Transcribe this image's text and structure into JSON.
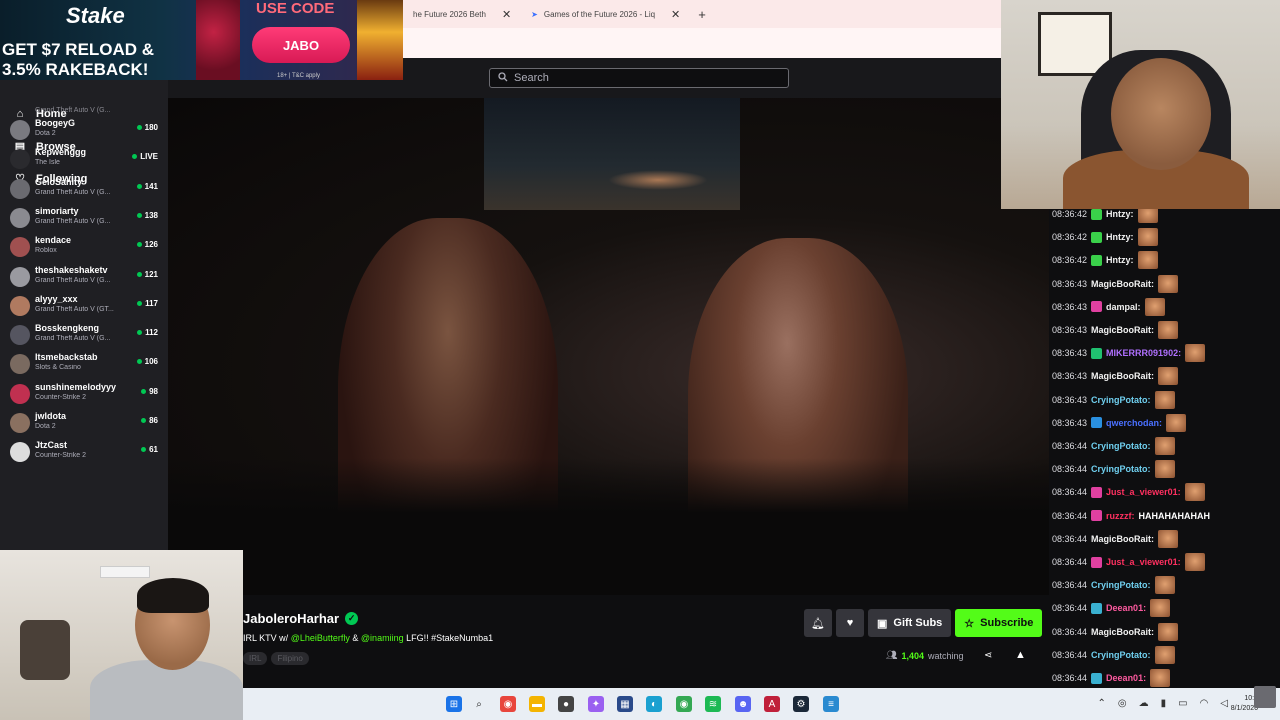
{
  "ad": {
    "brand": "Stake",
    "headline_line1": "GET $7 RELOAD &",
    "headline_line2": "3.5% RAKEBACK!",
    "use_code_label": "USE CODE",
    "code": "JABO",
    "fine_print": "18+ | T&C apply"
  },
  "browser": {
    "tabs": [
      {
        "label": "he Future 2026 Beth"
      },
      {
        "label": "Games of the Future 2026 - Liq"
      }
    ],
    "new_tab": "+"
  },
  "search": {
    "placeholder": "Search"
  },
  "sidebar": {
    "nav": [
      {
        "label": "Home",
        "icon": "home-icon"
      },
      {
        "label": "Browse",
        "icon": "browse-icon"
      },
      {
        "label": "Following",
        "icon": "heart-icon"
      }
    ],
    "partial_row": "Grand Theft Auto V (G...",
    "channels": [
      {
        "name": "BoogeyG",
        "game": "Dota 2",
        "viewers": "180",
        "color": "#7a7a80"
      },
      {
        "name": "Kepwenggg",
        "game": "The Isle",
        "viewers": "LIVE",
        "color": "#2a2a2e"
      },
      {
        "name": "GeloSanity",
        "game": "Grand Theft Auto V (G...",
        "viewers": "141",
        "color": "#6a6a70"
      },
      {
        "name": "simoriarty",
        "game": "Grand Theft Auto V (G...",
        "viewers": "138",
        "color": "#8a8a90"
      },
      {
        "name": "kendace",
        "game": "Roblox",
        "viewers": "126",
        "color": "#a05050"
      },
      {
        "name": "theshakeshaketv",
        "game": "Grand Theft Auto V (G...",
        "viewers": "121",
        "color": "#9a9aa0"
      },
      {
        "name": "alyyy_xxx",
        "game": "Grand Theft Auto V (GT...",
        "viewers": "117",
        "color": "#b07a60"
      },
      {
        "name": "Bosskengkeng",
        "game": "Grand Theft Auto V (G...",
        "viewers": "112",
        "color": "#555560"
      },
      {
        "name": "Itsmebackstab",
        "game": "Slots & Casino",
        "viewers": "106",
        "color": "#7a6a60"
      },
      {
        "name": "sunshinemelodyyy",
        "game": "Counter-Strike 2",
        "viewers": "98",
        "color": "#c03050"
      },
      {
        "name": "jwldota",
        "game": "Dota 2",
        "viewers": "86",
        "color": "#8a7060"
      },
      {
        "name": "JtzCast",
        "game": "Counter-Strike 2",
        "viewers": "61",
        "color": "#dddddd"
      }
    ]
  },
  "stream": {
    "streamer": "JaboleroHarhar",
    "title_prefix": "IRL KTV w/",
    "mention1": "@LheiButterfly",
    "amp": "&",
    "mention2": "@inamiing",
    "title_suffix": "LFG!! #StakeNumba1",
    "tags": [
      "IRL",
      "Filipino"
    ],
    "gift_label": "Gift Subs",
    "subscribe_label": "Subscribe",
    "viewer_count": "1,404",
    "viewer_suffix": "watching",
    "accent_color": "#53fc18"
  },
  "chat": {
    "messages": [
      {
        "time": "08:36:42",
        "user": "Hntzy:",
        "color": "#f2f2f2",
        "badge": "#3ad04a",
        "text": "",
        "emote": true
      },
      {
        "time": "08:36:42",
        "user": "Hntzy:",
        "color": "#f2f2f2",
        "badge": "#3ad04a",
        "text": "",
        "emote": true
      },
      {
        "time": "08:36:42",
        "user": "Hntzy:",
        "color": "#f2f2f2",
        "badge": "#3ad04a",
        "text": "",
        "emote": true
      },
      {
        "time": "08:36:43",
        "user": "MagicBooRait:",
        "color": "#f2f2f2",
        "badge": "",
        "text": "",
        "emote": true
      },
      {
        "time": "08:36:43",
        "user": "dampal:",
        "color": "#f2f2f2",
        "badge": "#e040a0",
        "text": "",
        "emote": true
      },
      {
        "time": "08:36:43",
        "user": "MagicBooRait:",
        "color": "#f2f2f2",
        "badge": "",
        "text": "",
        "emote": true
      },
      {
        "time": "08:36:43",
        "user": "MIKERRR091902:",
        "color": "#b070ff",
        "badge": "#20c070",
        "text": "",
        "emote": true
      },
      {
        "time": "08:36:43",
        "user": "MagicBooRait:",
        "color": "#f2f2f2",
        "badge": "",
        "text": "",
        "emote": true
      },
      {
        "time": "08:36:43",
        "user": "CryingPotato:",
        "color": "#70d0f0",
        "badge": "",
        "text": "",
        "emote": true
      },
      {
        "time": "08:36:43",
        "user": "qwerchodan:",
        "color": "#4a70ff",
        "badge": "#2a90e0",
        "text": "",
        "emote": true
      },
      {
        "time": "08:36:44",
        "user": "CryingPotato:",
        "color": "#70d0f0",
        "badge": "",
        "text": "",
        "emote": true
      },
      {
        "time": "08:36:44",
        "user": "CryingPotato:",
        "color": "#70d0f0",
        "badge": "",
        "text": "",
        "emote": true
      },
      {
        "time": "08:36:44",
        "user": "Just_a_viewer01:",
        "color": "#ff3060",
        "badge": "#e040a0",
        "text": "",
        "emote": true
      },
      {
        "time": "08:36:44",
        "user": "ruzzzf:",
        "color": "#ff3060",
        "badge": "#e040a0",
        "text": "HAHAHAHAHAH",
        "emote": false
      },
      {
        "time": "08:36:44",
        "user": "MagicBooRait:",
        "color": "#f2f2f2",
        "badge": "",
        "text": "",
        "emote": true
      },
      {
        "time": "08:36:44",
        "user": "Just_a_viewer01:",
        "color": "#ff3060",
        "badge": "#e040a0",
        "text": "",
        "emote": true
      },
      {
        "time": "08:36:44",
        "user": "CryingPotato:",
        "color": "#70d0f0",
        "badge": "",
        "text": "",
        "emote": true
      },
      {
        "time": "08:36:44",
        "user": "Deean01:",
        "color": "#ff5aa0",
        "badge": "#3ab0d0",
        "text": "",
        "emote": true
      },
      {
        "time": "08:36:44",
        "user": "MagicBooRait:",
        "color": "#f2f2f2",
        "badge": "",
        "text": "",
        "emote": true
      },
      {
        "time": "08:36:44",
        "user": "CryingPotato:",
        "color": "#70d0f0",
        "badge": "",
        "text": "",
        "emote": true
      },
      {
        "time": "08:36:44",
        "user": "Deean01:",
        "color": "#ff5aa0",
        "badge": "#3ab0d0",
        "text": "",
        "emote": true
      }
    ]
  },
  "taskbar": {
    "clock_time": "10:0",
    "clock_date": "8/1/2026"
  }
}
